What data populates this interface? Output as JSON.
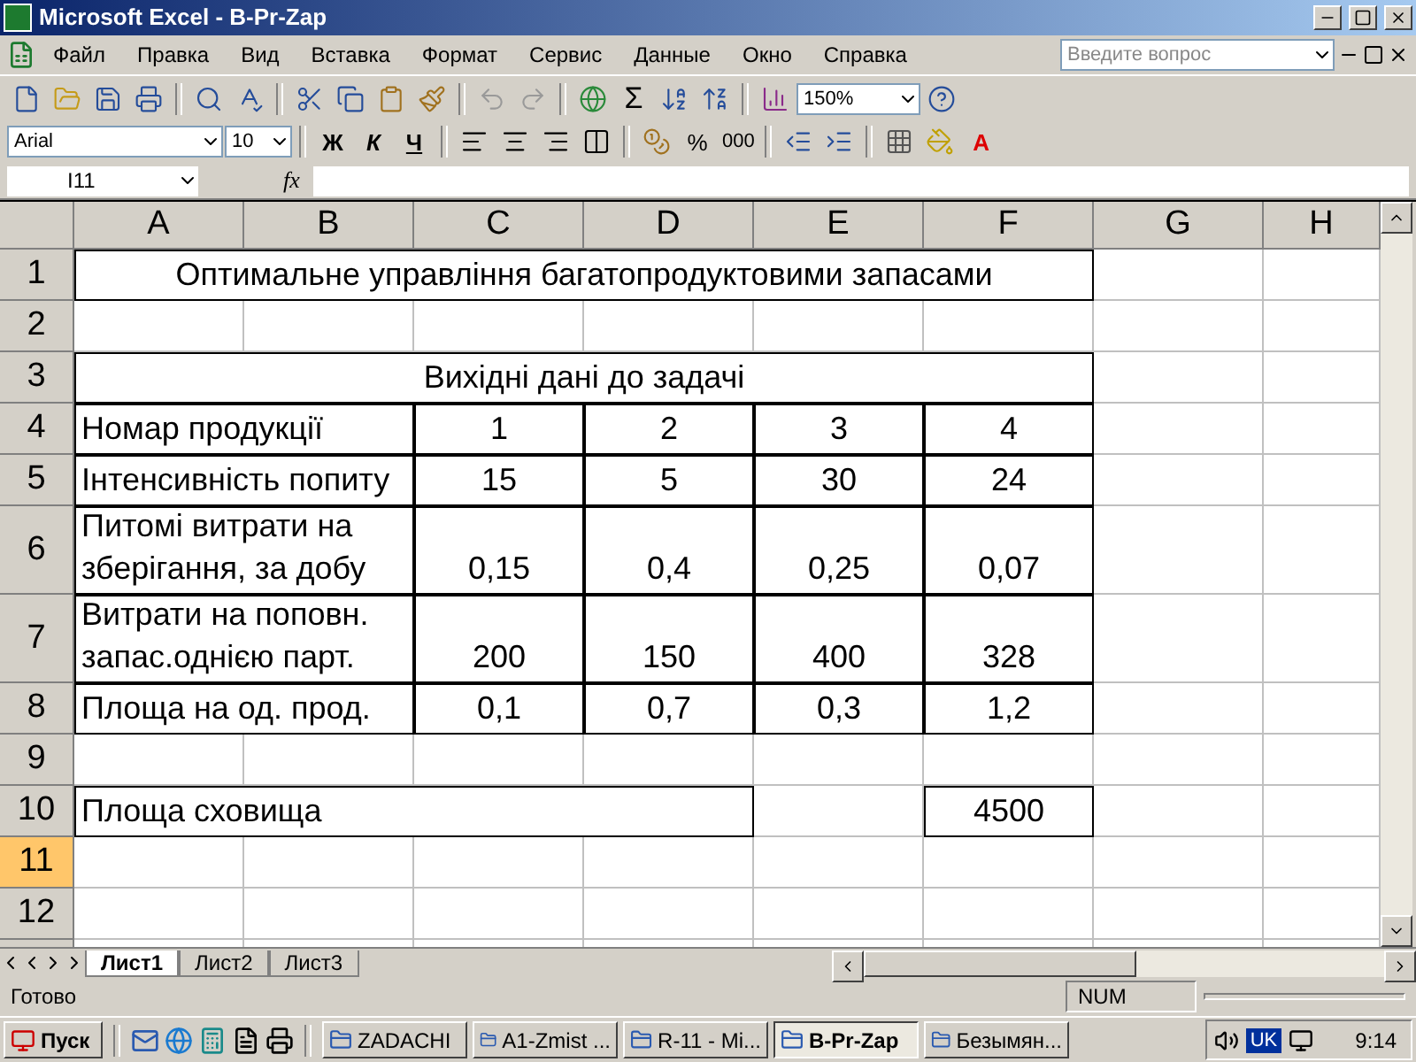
{
  "window": {
    "title": "Microsoft Excel - B-Pr-Zap"
  },
  "menu": [
    "Файл",
    "Правка",
    "Вид",
    "Вставка",
    "Формат",
    "Сервис",
    "Данные",
    "Окно",
    "Справка"
  ],
  "help_search": {
    "placeholder": "Введите вопрос"
  },
  "toolbar": {
    "sum": "Σ",
    "zoom": "150%"
  },
  "formatting": {
    "font": "Arial",
    "size": "10",
    "bold": "Ж",
    "italic": "К",
    "underline": "Ч",
    "percent": "%",
    "thousands": "000",
    "font_color": "A"
  },
  "formula_bar": {
    "name_box": "I11",
    "fx": "fx"
  },
  "columns": [
    {
      "label": "A"
    },
    {
      "label": "B"
    },
    {
      "label": "C"
    },
    {
      "label": "D"
    },
    {
      "label": "E"
    },
    {
      "label": "F"
    },
    {
      "label": "G"
    },
    {
      "label": "H"
    }
  ],
  "rows": [
    {
      "number": "1",
      "selected": false,
      "kind": "title",
      "title": "Оптимальне управління багатопродуктовими запасами"
    },
    {
      "number": "2",
      "selected": false,
      "kind": "empty"
    },
    {
      "number": "3",
      "selected": false,
      "kind": "title",
      "title": "Вихідні дані до задачі"
    },
    {
      "number": "4",
      "selected": false,
      "kind": "data",
      "label": "Номар продукції",
      "values": [
        "1",
        "2",
        "3",
        "4"
      ]
    },
    {
      "number": "5",
      "selected": false,
      "kind": "data",
      "label": "Інтенсивність попиту",
      "values": [
        "15",
        "5",
        "30",
        "24"
      ]
    },
    {
      "number": "6",
      "selected": false,
      "kind": "data",
      "label": "Питомі витрати на зберігання, за добу",
      "values": [
        "0,15",
        "0,4",
        "0,25",
        "0,07"
      ]
    },
    {
      "number": "7",
      "selected": false,
      "kind": "data",
      "label": "Витрати на поповн. запас.однією парт.",
      "values": [
        "200",
        "150",
        "400",
        "328"
      ]
    },
    {
      "number": "8",
      "selected": false,
      "kind": "data",
      "label": "Площа на од. прод.",
      "values": [
        "0,1",
        "0,7",
        "0,3",
        "1,2"
      ]
    },
    {
      "number": "9",
      "selected": false,
      "kind": "empty"
    },
    {
      "number": "10",
      "selected": false,
      "kind": "total",
      "label": "Площа сховища",
      "value": "4500"
    },
    {
      "number": "11",
      "selected": true,
      "kind": "empty"
    },
    {
      "number": "12",
      "selected": false,
      "kind": "empty"
    }
  ],
  "sheet_tabs": [
    {
      "label": "Лист1",
      "selected": true
    },
    {
      "label": "Лист2",
      "selected": false
    },
    {
      "label": "Лист3",
      "selected": false
    }
  ],
  "status_bar": {
    "text": "Готово",
    "indicator": "NUM"
  },
  "taskbar": {
    "start": "Пуск",
    "tasks": [
      {
        "label": "ZADACHI",
        "selected": false
      },
      {
        "label": "A1-Zmist ...",
        "selected": false
      },
      {
        "label": "R-11 - Mi...",
        "selected": false
      },
      {
        "label": "B-Pr-Zap",
        "selected": true
      },
      {
        "label": "Безымян...",
        "selected": false
      }
    ],
    "language": "UK",
    "clock": "9:14"
  }
}
